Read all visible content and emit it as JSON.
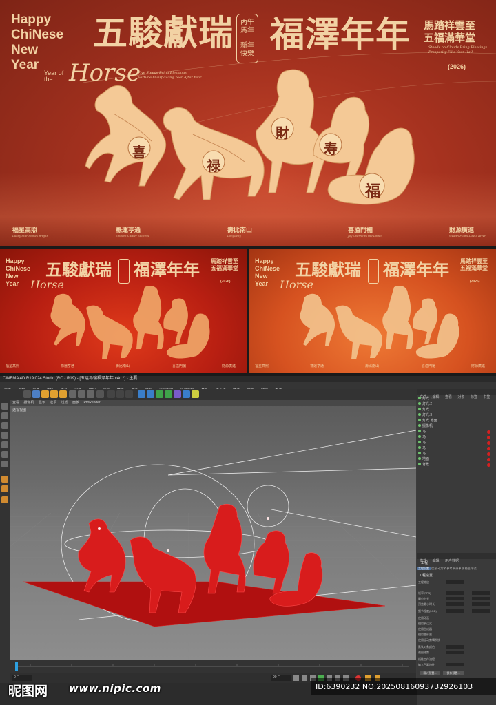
{
  "poster": {
    "happy_lines": [
      "Happy",
      "ChiNese",
      "New",
      "Year"
    ],
    "year_of_the": [
      "Year of",
      "the"
    ],
    "horse_word": "Horse",
    "title_left": "五駿獻瑞",
    "seal_top": "丙午",
    "seal_mid": "馬年",
    "seal_bottom_1": "新年",
    "seal_bottom_2": "快樂",
    "title_right": "福澤年年",
    "right_line_1": "馬踏祥雲至",
    "right_line_2": "五福滿華堂",
    "right_en": "Steeds on Clouds Bring Blessings Prosperity Fills Your Hall",
    "year_badge": "(2026)",
    "sub_en_1": "Five Steeds Bring Blessings",
    "sub_en_2": "Fortune Overflowing Year After Year",
    "horse_chars": [
      "喜",
      "禄",
      "財",
      "寿",
      "福"
    ],
    "blessings": [
      {
        "cn": "福星高照",
        "en": "Lucky Star Shines Bright"
      },
      {
        "cn": "祿運亨通",
        "en": "Smooth Career Success"
      },
      {
        "cn": "壽比南山",
        "en": "Longevity"
      },
      {
        "cn": "喜溢門楣",
        "en": "Joy Overflows the Lintel"
      },
      {
        "cn": "財源廣進",
        "en": "Wealth Flows Like a River"
      }
    ],
    "colors": {
      "bg": "#a6321f",
      "cream": "#f2d2a4",
      "papercut": "#f4c996"
    }
  },
  "thumbnails": [
    {
      "variant": "red",
      "bg": "#c0200f"
    },
    {
      "variant": "orange",
      "bg": "#d65220"
    }
  ],
  "c4d": {
    "window_title": "CINEMA 4D R19.024 Studio (RC - R19) - [五运马瑞福泽年年.c4d *] - 主要",
    "menu": [
      "文件",
      "编辑",
      "创建",
      "选择",
      "工具",
      "网格",
      "捕捉",
      "动画",
      "模拟",
      "渲染",
      "雕刻",
      "运动跟踪",
      "运动图形",
      "角色",
      "流水线",
      "插件",
      "脚本",
      "窗口",
      "帮助"
    ],
    "viewport_label": "透视视图",
    "viewport_menu": [
      "查看",
      "摄像机",
      "显示",
      "选项",
      "过滤",
      "面板",
      "ProRender"
    ],
    "right_tabs": [
      "文件",
      "编辑",
      "查看",
      "对象",
      "标签",
      "书签"
    ],
    "objects": [
      "灯光.1",
      "灯光.2",
      "灯光",
      "灯光.3",
      "灯光.地面",
      "摄像机",
      "马",
      "马",
      "马",
      "马",
      "马",
      "地面",
      "背景"
    ],
    "attr_tabs": [
      "模式",
      "编辑",
      "用户数据"
    ],
    "attr_title": "工程",
    "attr_subtabs": [
      "工程设置",
      "信息",
      "动力学",
      "参考",
      "待办事项",
      "插值",
      "节点"
    ],
    "attr_section": "工程设置",
    "attr_rows": [
      "工程缩放",
      "帧率(FPS)",
      "最小时长",
      "预览最小时长",
      "细节程度(LOD)",
      "使用动画",
      "使用表达式",
      "使用生成器",
      "使用变形器",
      "使用运动剪辑系统",
      "默认对象颜色",
      "视图修剪",
      "线性工作流程",
      "输入色彩特性"
    ],
    "buttons": [
      "载入预置...",
      "保存预置..."
    ],
    "timeline_end": "90 F",
    "frame_field": "0 F"
  },
  "watermark": {
    "logo": "昵图网",
    "url": "www.nipic.com",
    "id": "ID:6390232 NO:20250816093732926103"
  }
}
